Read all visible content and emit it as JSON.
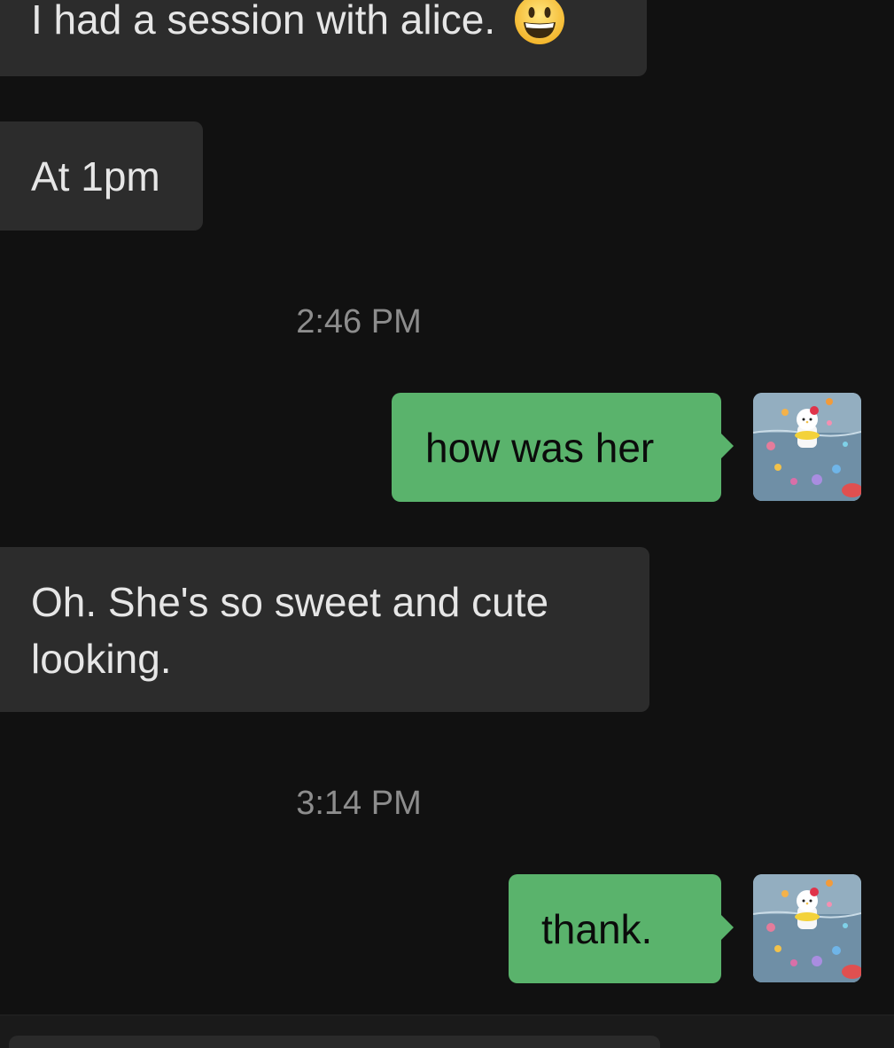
{
  "chat": {
    "messages": [
      {
        "direction": "incoming",
        "text": "I had a session with alice.",
        "emoji": "grinning-face"
      },
      {
        "direction": "incoming",
        "text": "At 1pm"
      },
      {
        "timestamp": "2:46 PM"
      },
      {
        "direction": "outgoing",
        "text": "how was her"
      },
      {
        "direction": "incoming",
        "text_line1": "Oh. She's so sweet and cute",
        "text_line2": "looking."
      },
      {
        "timestamp": "3:14 PM"
      },
      {
        "direction": "outgoing",
        "text": "thank."
      }
    ]
  },
  "colors": {
    "background": "#111111",
    "incoming_bubble": "#2c2c2c",
    "outgoing_bubble": "#5ab36c",
    "timestamp_text": "#8d8d8d"
  },
  "icons": {
    "avatar": "hello-kitty-aquarium-avatar-icon",
    "emoji": "grinning-face-icon"
  }
}
